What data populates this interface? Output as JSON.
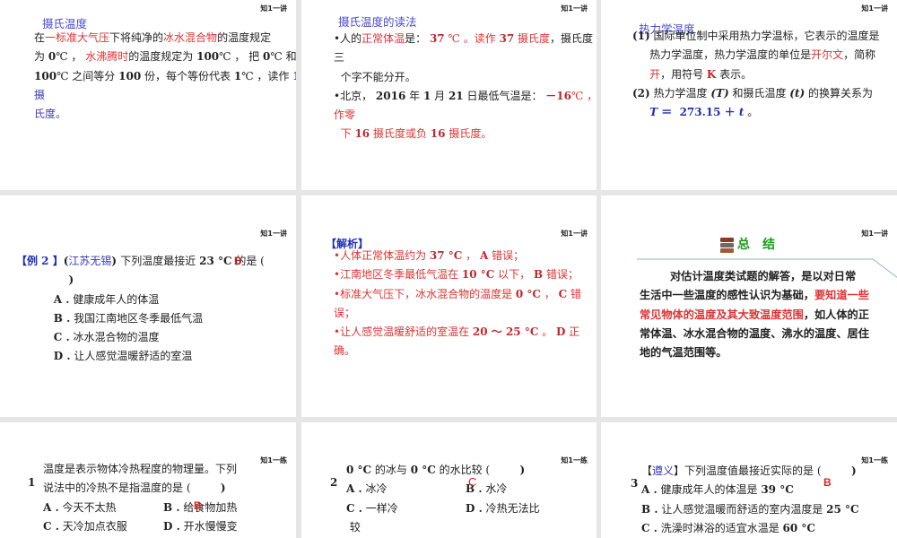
{
  "slides": [
    {
      "tag": "知1一讲",
      "title": "摄氏温度",
      "lines": [
        [
          {
            "t": "在"
          },
          {
            "t": "一标准大气压",
            "s": "red"
          },
          {
            "t": "下将纯净的"
          },
          {
            "t": "冰水混合物",
            "s": "red"
          },
          {
            "t": "的温度规定"
          }
        ],
        [
          {
            "t": "为 "
          },
          {
            "t": "0",
            "s": "b"
          },
          {
            "t": "℃ ， "
          },
          {
            "t": "水沸腾时",
            "s": "red"
          },
          {
            "t": "的温度规定为 "
          },
          {
            "t": "100",
            "s": "b"
          },
          {
            "t": "℃ ， 把 "
          },
          {
            "t": "0",
            "s": "b"
          },
          {
            "t": "℃ 和"
          }
        ],
        [
          {
            "t": "100",
            "s": "b"
          },
          {
            "t": "℃ 之间等分 "
          },
          {
            "t": "100",
            "s": "b"
          },
          {
            "t": " 份，每个等份代表 "
          },
          {
            "t": "1",
            "s": "b"
          },
          {
            "t": "℃ ，读作 "
          },
          {
            "t": "1",
            "s": "dblue"
          }
        ],
        [
          {
            "t": "摄",
            "s": "blue"
          }
        ],
        [
          {
            "t": "氏度。",
            "s": "blue"
          }
        ]
      ]
    },
    {
      "tag": "知1一讲",
      "title": "摄氏温度的读法",
      "lines": [
        [
          {
            "t": "•人的"
          },
          {
            "t": "正常体温",
            "s": "red"
          },
          {
            "t": "是： "
          },
          {
            "t": "37",
            "s": "dred b"
          },
          {
            "t": " ℃ 。读作 ",
            "s": "red"
          },
          {
            "t": "37",
            "s": "dred b"
          },
          {
            "t": " 摄氏度",
            "s": "red"
          },
          {
            "t": "，摄氏度"
          }
        ],
        [
          {
            "t": "三"
          }
        ],
        [
          {
            "t": "  个字不能分开。"
          }
        ],
        [
          {
            "t": "•北京， "
          },
          {
            "t": "2016",
            "s": "b"
          },
          {
            "t": " 年 "
          },
          {
            "t": "1",
            "s": "b"
          },
          {
            "t": " 月 "
          },
          {
            "t": "21",
            "s": "b"
          },
          {
            "t": " 日最低气温是： "
          },
          {
            "t": "－16",
            "s": "dred b"
          },
          {
            "t": "℃ ， 读",
            "s": "red"
          }
        ],
        [
          {
            "t": "作零",
            "s": "red"
          }
        ],
        [
          {
            "t": "  下 ",
            "s": "red"
          },
          {
            "t": "16",
            "s": "dred b"
          },
          {
            "t": " 摄氏度或负 ",
            "s": "red"
          },
          {
            "t": "16",
            "s": "dred b"
          },
          {
            "t": " 摄氏度。",
            "s": "red"
          }
        ]
      ]
    },
    {
      "tag": "知1一讲",
      "title": "热力学温度",
      "lines": [
        [
          {
            "t": "(1)",
            "s": "b"
          },
          {
            "t": " 国际单位制中采用热力学温标，它表示的温度是"
          }
        ],
        [
          {
            "t": "     热力学温度，热力学温度的单位是"
          },
          {
            "t": "开尔文",
            "s": "red"
          },
          {
            "t": "，简称"
          }
        ],
        [
          {
            "t": "     "
          },
          {
            "t": "开",
            "s": "red"
          },
          {
            "t": "，用符号 "
          },
          {
            "t": "K",
            "s": "dred b"
          },
          {
            "t": " 表示。"
          }
        ],
        [
          {
            "t": "(2)",
            "s": "b"
          },
          {
            "t": " 热力学温度 "
          },
          {
            "t": "(T)",
            "s": "b i"
          },
          {
            "t": " 和摄氏温度 "
          },
          {
            "t": "(t)",
            "s": "b i"
          },
          {
            "t": " 的换算关系为"
          }
        ],
        [
          {
            "t": "     "
          },
          {
            "t": "T",
            "s": "dblue i"
          },
          {
            "t": " ＝  ",
            "s": "dblue"
          },
          {
            "t": "273.15",
            "s": "dblue"
          },
          {
            "t": " ＋ ",
            "s": "dblue"
          },
          {
            "t": "t",
            "s": "dblue i"
          },
          {
            "t": " 。"
          }
        ]
      ]
    },
    {
      "tag": "知1一讲",
      "answer": "D",
      "lines": [
        [
          {
            "t": "【例 2 】",
            "s": "dblue"
          },
          {
            "t": "(",
            "s": "b"
          },
          {
            "t": "江苏无锡",
            "s": "blue"
          },
          {
            "t": ") ",
            "s": "b"
          },
          {
            "t": "下列温度最接近 "
          },
          {
            "t": "23 °C",
            "s": "b"
          },
          {
            "t": " 的是 ("
          }
        ],
        [
          {
            "t": "              )",
            "s": "b"
          }
        ],
        [
          {
            "t": "          A .",
            "s": "b"
          },
          {
            "t": " 健康成年人的体温"
          }
        ],
        [
          {
            "t": "          B .",
            "s": "b"
          },
          {
            "t": " 我国江南地区冬季最低气温"
          }
        ],
        [
          {
            "t": "          C .",
            "s": "b"
          },
          {
            "t": " 冰水混合物的温度"
          }
        ],
        [
          {
            "t": "          D .",
            "s": "b"
          },
          {
            "t": " 让人感觉温暖舒适的室温"
          }
        ]
      ]
    },
    {
      "tag": "知1一讲",
      "title": "【解析】",
      "lines": [
        [
          {
            "t": "•人体正常体温约为 ",
            "s": "red"
          },
          {
            "t": "37 °C",
            "s": "dred b"
          },
          {
            "t": " ， ",
            "s": "red"
          },
          {
            "t": "A",
            "s": "dred b"
          },
          {
            "t": " 错误；",
            "s": "red"
          }
        ],
        [
          {
            "t": "•江南地区冬季最低气温在 ",
            "s": "red"
          },
          {
            "t": "10 °C",
            "s": "dred b"
          },
          {
            "t": " 以下， ",
            "s": "red"
          },
          {
            "t": "B",
            "s": "dred b"
          },
          {
            "t": " 错误；",
            "s": "red"
          }
        ],
        [
          {
            "t": "•标准大气压下，冰水混合物的温度是 ",
            "s": "red"
          },
          {
            "t": "0 °C",
            "s": "dred b"
          },
          {
            "t": " ， ",
            "s": "red"
          },
          {
            "t": "C",
            "s": "dred b"
          },
          {
            "t": " 错",
            "s": "red"
          }
        ],
        [
          {
            "t": "误；",
            "s": "red"
          }
        ],
        [
          {
            "t": "•让人感觉温暖舒适的室温在 ",
            "s": "red"
          },
          {
            "t": "20 ～ 25 °C",
            "s": "dred b"
          },
          {
            "t": " 。 ",
            "s": "red"
          },
          {
            "t": "D",
            "s": "dred b"
          },
          {
            "t": " 正",
            "s": "red"
          }
        ],
        [
          {
            "t": "确。",
            "s": "red"
          }
        ]
      ]
    },
    {
      "tag": "知1一讲",
      "title": "总　结",
      "lines": [
        [
          {
            "t": "        对估计温度类试题的解答，是以对日常",
            "s": "b"
          }
        ],
        [
          {
            "t": "生活中一些温度的感性认识为基础，",
            "s": "b"
          },
          {
            "t": "要知道一些",
            "s": "red b"
          }
        ],
        [
          {
            "t": "常见物体的温度及其大致温度范围",
            "s": "red b"
          },
          {
            "t": "，如人体的正",
            "s": "b"
          }
        ],
        [
          {
            "t": "常体温、冰水混合物的温度、沸水的温度、居住",
            "s": "b"
          }
        ],
        [
          {
            "t": "地的气温范围等。",
            "s": "b"
          }
        ]
      ]
    },
    {
      "tag": "知1一练",
      "number": "1",
      "answer": "B",
      "lines": [
        [
          {
            "t": "温度是表示物体冷热程度的物理量。下列"
          }
        ],
        [
          {
            "t": "说法中的冷热不是指温度的是 ("
          },
          {
            "t": "        )",
            "s": "b"
          }
        ],
        {
          "cols": [
            [
              {
                "t": "A .",
                "s": "b"
              },
              {
                "t": " 今天不太热"
              }
            ],
            [
              {
                "t": "B .",
                "s": "b"
              },
              {
                "t": " 给食物加热"
              }
            ]
          ]
        },
        {
          "cols": [
            [
              {
                "t": "C .",
                "s": "b"
              },
              {
                "t": " 天冷加点衣服"
              }
            ],
            [
              {
                "t": "D .",
                "s": "b"
              },
              {
                "t": " 开水慢慢变"
              }
            ]
          ]
        }
      ]
    },
    {
      "tag": "知1一练",
      "number": "2",
      "answer": "C",
      "lines": [
        [
          {
            "t": "0 °C",
            "s": "b"
          },
          {
            "t": " 的冰与 "
          },
          {
            "t": "0 °C",
            "s": "b"
          },
          {
            "t": " 的水比较 ("
          },
          {
            "t": "        )",
            "s": "b"
          }
        ],
        {
          "cols": [
            [
              {
                "t": "A .",
                "s": "b"
              },
              {
                "t": " 冰冷"
              }
            ],
            [
              {
                "t": "B .",
                "s": "b"
              },
              {
                "t": " 水冷"
              }
            ]
          ]
        },
        {
          "cols": [
            [
              {
                "t": "C .",
                "s": "b"
              },
              {
                "t": " 一样冷"
              }
            ],
            [
              {
                "t": "D .",
                "s": "b"
              },
              {
                "t": " 冷热无法比"
              }
            ]
          ]
        },
        [
          {
            "t": " 较"
          }
        ]
      ]
    },
    {
      "tag": "知1一练",
      "number": "3",
      "answer": "B",
      "lines": [
        [
          {
            "t": "【"
          },
          {
            "t": "遵义",
            "s": "blue"
          },
          {
            "t": "】下列温度值最接近实际的是 ("
          },
          {
            "t": "        )",
            "s": "b"
          }
        ],
        [
          {
            "t": "A .",
            "s": "b"
          },
          {
            "t": " 健康成年人的体温是 "
          },
          {
            "t": "39 °C",
            "s": "b"
          }
        ],
        [
          {
            "t": "B .",
            "s": "b"
          },
          {
            "t": " 让人感觉温暖而舒适的室内温度是 "
          },
          {
            "t": "25 °C",
            "s": "b"
          }
        ],
        [
          {
            "t": "C .",
            "s": "b"
          },
          {
            "t": " 洗澡时淋浴的适宜水温是 "
          },
          {
            "t": "60 °C",
            "s": "b"
          }
        ]
      ]
    }
  ]
}
